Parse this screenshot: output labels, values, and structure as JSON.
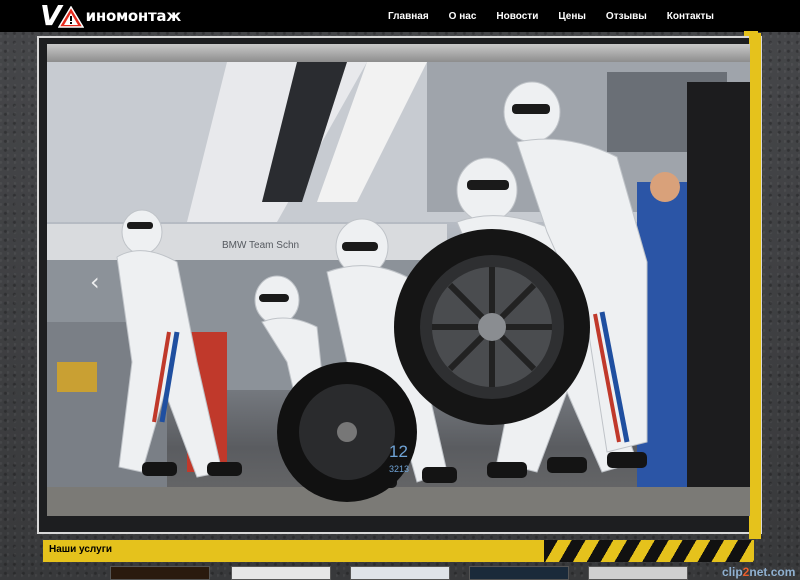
{
  "header": {
    "logo_letter": "V",
    "logo_text": "иномонтаж",
    "nav": [
      {
        "label": "Главная"
      },
      {
        "label": "О нас"
      },
      {
        "label": "Новости"
      },
      {
        "label": "Цены"
      },
      {
        "label": "Отзывы"
      },
      {
        "label": "Контакты"
      }
    ]
  },
  "slider": {
    "arrow_prev": "‹",
    "caption_number": "12",
    "caption_sub": "3213",
    "photo_sign": "BMW Team Schn"
  },
  "services": {
    "title": "Наши услуги"
  },
  "watermark": {
    "part1": "clip",
    "part2": "2",
    "part3": "net.com"
  },
  "colors": {
    "accent_yellow": "#e5c21c",
    "topbar": "#000000",
    "caption_blue": "#6fa3d6"
  }
}
